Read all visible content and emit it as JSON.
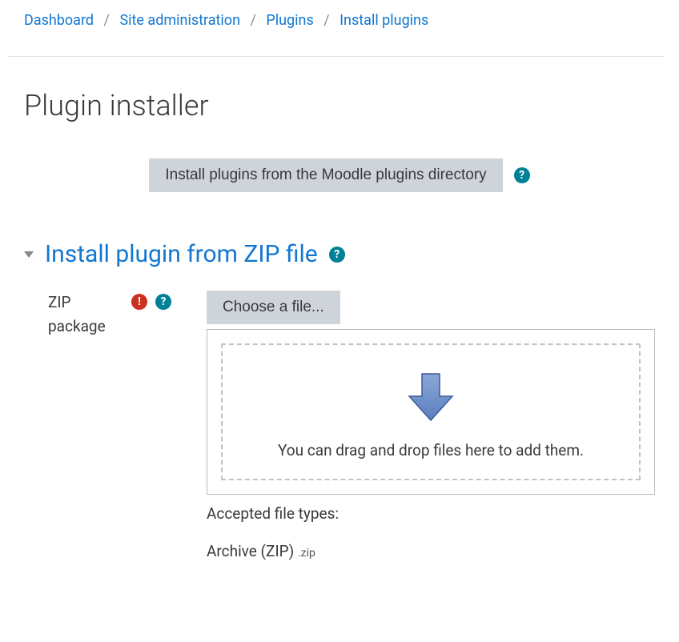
{
  "breadcrumb": {
    "items": [
      {
        "label": "Dashboard"
      },
      {
        "label": "Site administration"
      },
      {
        "label": "Plugins"
      },
      {
        "label": "Install plugins"
      }
    ],
    "separator": "/"
  },
  "page_title": "Plugin installer",
  "install_from_directory": {
    "button_label": "Install plugins from the Moodle plugins directory"
  },
  "section": {
    "title": "Install plugin from ZIP file"
  },
  "form": {
    "zip_label": "ZIP package",
    "choose_file_label": "Choose a file...",
    "dropzone_text": "You can drag and drop files here to add them.",
    "accepted_label": "Accepted file types:",
    "accepted_type_name": "Archive (ZIP)",
    "accepted_type_ext": ".zip"
  },
  "icons": {
    "required_glyph": "!",
    "help_glyph": "?"
  }
}
